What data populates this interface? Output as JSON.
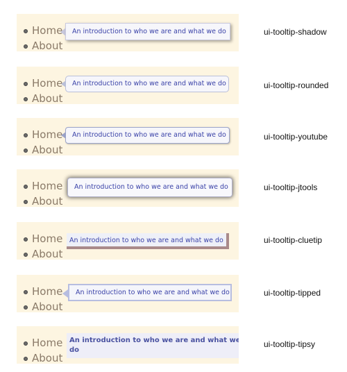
{
  "nav": {
    "home": "Home",
    "about": "About"
  },
  "tooltip_text": "An introduction to who we are and what we do",
  "demos": [
    {
      "name": "ui-tooltip-shadow"
    },
    {
      "name": "ui-tooltip-rounded"
    },
    {
      "name": "ui-tooltip-youtube"
    },
    {
      "name": "ui-tooltip-jtools"
    },
    {
      "name": "ui-tooltip-cluetip"
    },
    {
      "name": "ui-tooltip-tipped"
    },
    {
      "name": "ui-tooltip-tipsy"
    }
  ]
}
